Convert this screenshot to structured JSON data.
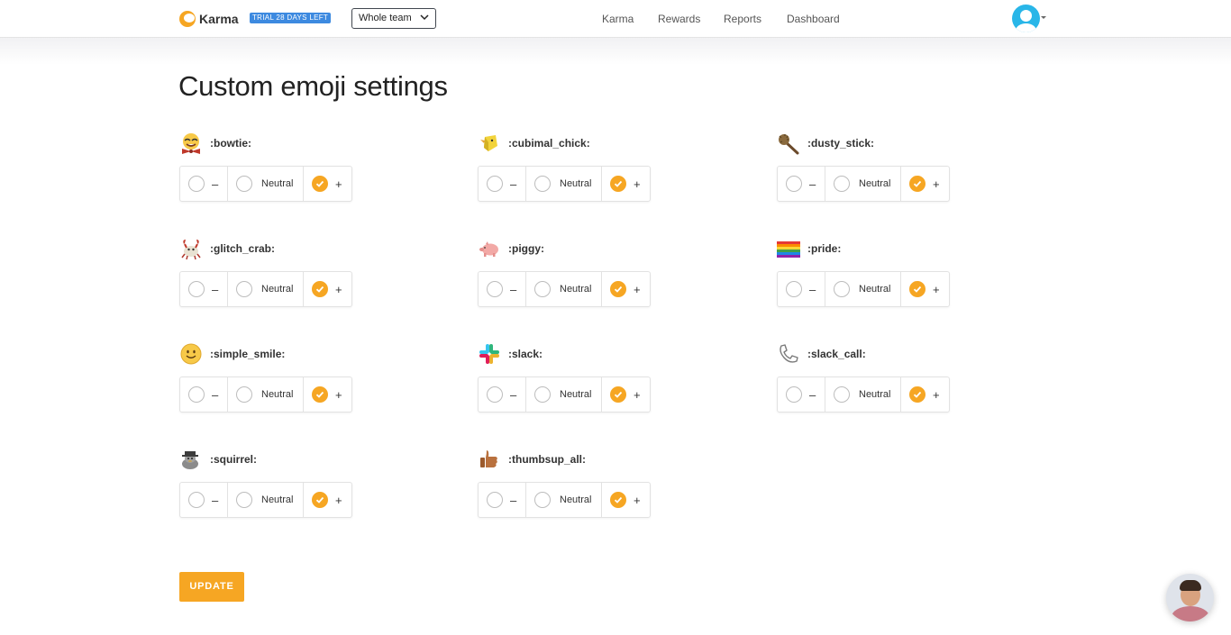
{
  "header": {
    "brand": "Karma",
    "trial_badge": "TRIAL 28 DAYS LEFT",
    "team_select": "Whole team",
    "nav": [
      "Karma",
      "Rewards",
      "Reports",
      "Dashboard"
    ]
  },
  "page_title": "Custom emoji settings",
  "options": {
    "negative": "–",
    "neutral": "Neutral",
    "positive": "+"
  },
  "emojis": [
    {
      "name": ":bowtie:",
      "selected": "positive",
      "icon": "bowtie-emoji-icon"
    },
    {
      "name": ":cubimal_chick:",
      "selected": "positive",
      "icon": "cubimal-chick-emoji-icon"
    },
    {
      "name": ":dusty_stick:",
      "selected": "positive",
      "icon": "dusty-stick-emoji-icon"
    },
    {
      "name": ":glitch_crab:",
      "selected": "positive",
      "icon": "glitch-crab-emoji-icon"
    },
    {
      "name": ":piggy:",
      "selected": "positive",
      "icon": "piggy-emoji-icon"
    },
    {
      "name": ":pride:",
      "selected": "positive",
      "icon": "pride-flag-emoji-icon"
    },
    {
      "name": ":simple_smile:",
      "selected": "positive",
      "icon": "simple-smile-emoji-icon"
    },
    {
      "name": ":slack:",
      "selected": "positive",
      "icon": "slack-emoji-icon"
    },
    {
      "name": ":slack_call:",
      "selected": "positive",
      "icon": "slack-call-emoji-icon"
    },
    {
      "name": ":squirrel:",
      "selected": "positive",
      "icon": "squirrel-emoji-icon"
    },
    {
      "name": ":thumbsup_all:",
      "selected": "positive",
      "icon": "thumbsup-emoji-icon"
    }
  ],
  "update_button": "UPDATE",
  "colors": {
    "accent": "#f6a623",
    "badge": "#3d8ae0",
    "avatar": "#29b6e8"
  }
}
